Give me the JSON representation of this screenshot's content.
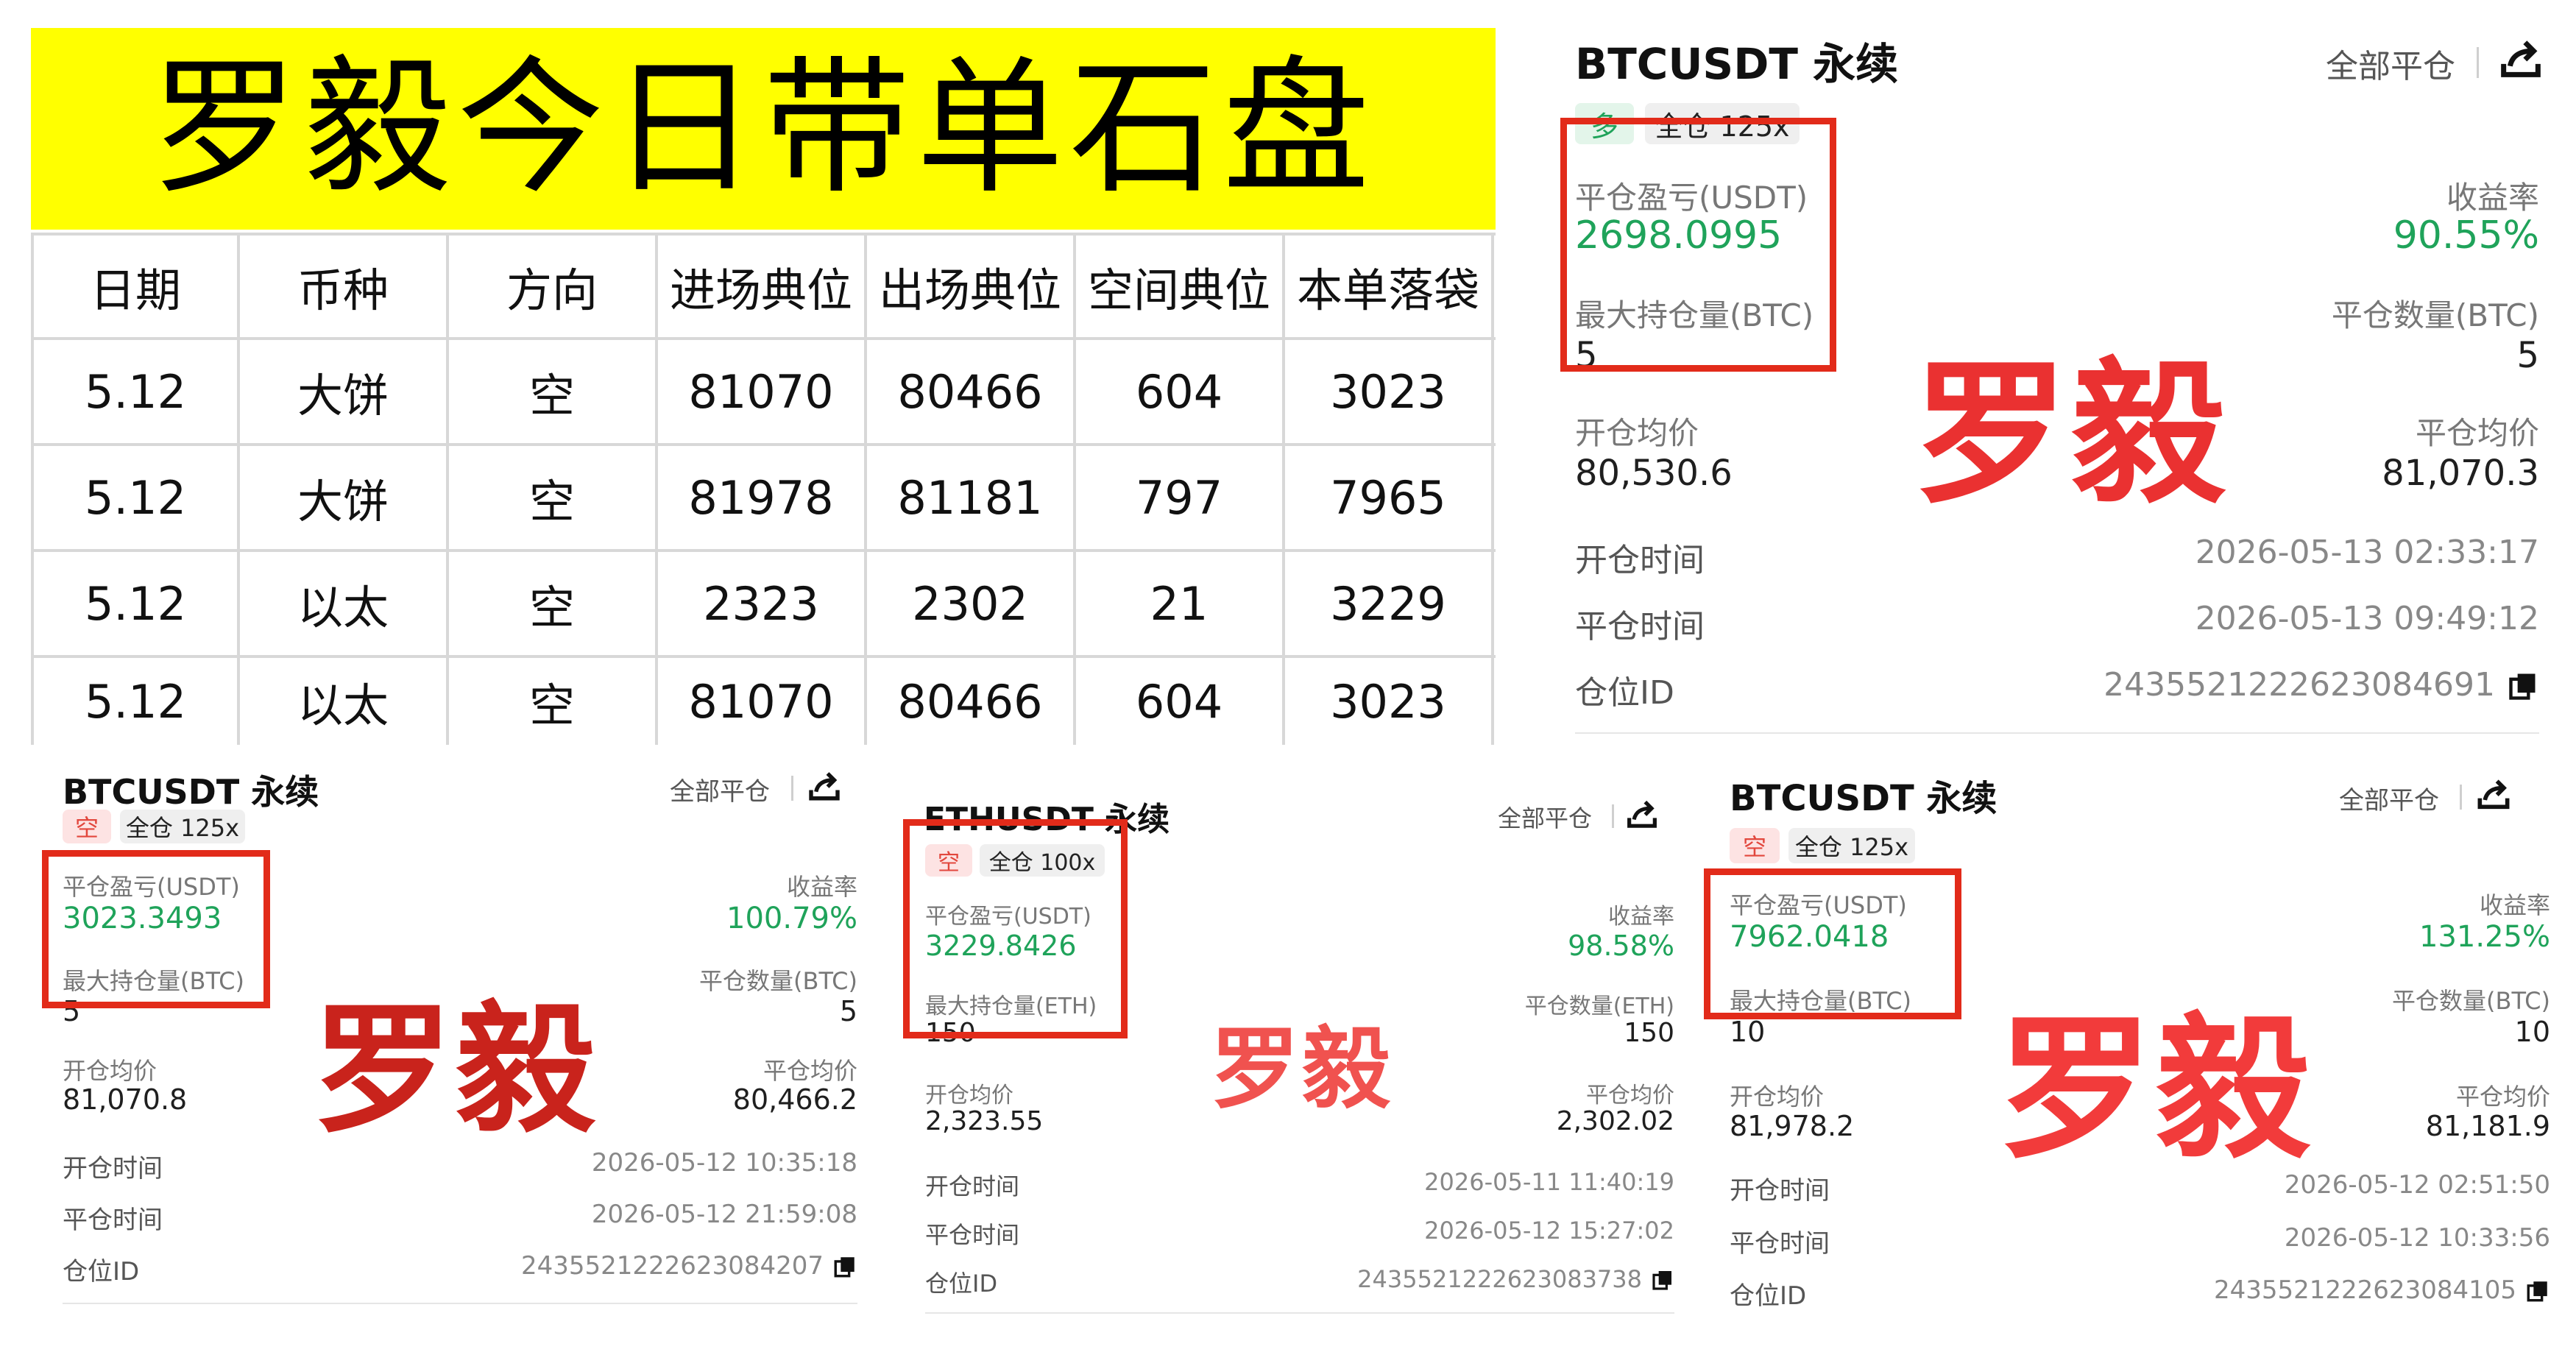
{
  "banner": {
    "title": "罗毅今日带单石盘"
  },
  "table": {
    "headers": [
      "日期",
      "币种",
      "方向",
      "进场典位",
      "出场典位",
      "空间典位",
      "本单落袋"
    ],
    "rows": [
      [
        "5.12",
        "大饼",
        "空",
        "81070",
        "80466",
        "604",
        "3023"
      ],
      [
        "5.12",
        "大饼",
        "空",
        "81978",
        "81181",
        "797",
        "7965"
      ],
      [
        "5.12",
        "以太",
        "空",
        "2323",
        "2302",
        "21",
        "3229"
      ],
      [
        "5.12",
        "以太",
        "空",
        "81070",
        "80466",
        "604",
        "3023"
      ]
    ]
  },
  "cards": {
    "main": {
      "title": "BTCUSDT 永续",
      "close_all": "全部平仓",
      "side": "多",
      "margin": "全仓 125x",
      "pnl_label": "平仓盈亏(USDT)",
      "pnl": "2698.0995",
      "roi_label": "收益率",
      "roi": "90.55%",
      "maxpos_label": "最大持仓量(BTC)",
      "maxpos": "5",
      "closeqty_label": "平仓数量(BTC)",
      "closeqty": "5",
      "open_avg_label": "开仓均价",
      "open_avg": "80,530.6",
      "close_avg_label": "平仓均价",
      "close_avg": "81,070.3",
      "open_time_label": "开仓时间",
      "open_time": "2026-05-13 02:33:17",
      "close_time_label": "平仓时间",
      "close_time": "2026-05-13 09:49:12",
      "pos_id_label": "仓位ID",
      "pos_id": "2435521222623084691",
      "watermark": "罗毅"
    },
    "bl": {
      "title": "BTCUSDT 永续",
      "close_all": "全部平仓",
      "side": "空",
      "margin": "全仓 125x",
      "pnl_label": "平仓盈亏(USDT)",
      "pnl": "3023.3493",
      "roi_label": "收益率",
      "roi": "100.79%",
      "maxpos_label": "最大持仓量(BTC)",
      "maxpos": "5",
      "closeqty_label": "平仓数量(BTC)",
      "closeqty": "5",
      "open_avg_label": "开仓均价",
      "open_avg": "81,070.8",
      "close_avg_label": "平仓均价",
      "close_avg": "80,466.2",
      "open_time_label": "开仓时间",
      "open_time": "2026-05-12 10:35:18",
      "close_time_label": "平仓时间",
      "close_time": "2026-05-12 21:59:08",
      "pos_id_label": "仓位ID",
      "pos_id": "2435521222623084207",
      "watermark": "罗毅"
    },
    "bm": {
      "title": "ETHUSDT 永续",
      "close_all": "全部平仓",
      "side": "空",
      "margin": "全仓 100x",
      "pnl_label": "平仓盈亏(USDT)",
      "pnl": "3229.8426",
      "roi_label": "收益率",
      "roi": "98.58%",
      "maxpos_label": "最大持仓量(ETH)",
      "maxpos": "150",
      "closeqty_label": "平仓数量(ETH)",
      "closeqty": "150",
      "open_avg_label": "开仓均价",
      "open_avg": "2,323.55",
      "close_avg_label": "平仓均价",
      "close_avg": "2,302.02",
      "open_time_label": "开仓时间",
      "open_time": "2026-05-11 11:40:19",
      "close_time_label": "平仓时间",
      "close_time": "2026-05-12 15:27:02",
      "pos_id_label": "仓位ID",
      "pos_id": "2435521222623083738",
      "watermark": "罗毅"
    },
    "br": {
      "title": "BTCUSDT 永续",
      "close_all": "全部平仓",
      "side": "空",
      "margin": "全仓 125x",
      "pnl_label": "平仓盈亏(USDT)",
      "pnl": "7962.0418",
      "roi_label": "收益率",
      "roi": "131.25%",
      "maxpos_label": "最大持仓量(BTC)",
      "maxpos": "10",
      "closeqty_label": "平仓数量(BTC)",
      "closeqty": "10",
      "open_avg_label": "开仓均价",
      "open_avg": "81,978.2",
      "close_avg_label": "平仓均价",
      "close_avg": "81,181.9",
      "open_time_label": "开仓时间",
      "open_time": "2026-05-12 02:51:50",
      "close_time_label": "平仓时间",
      "close_time": "2026-05-12 10:33:56",
      "pos_id_label": "仓位ID",
      "pos_id": "2435521222623084105",
      "watermark": "罗毅"
    }
  },
  "colors": {
    "profit": "#1fa35a",
    "short": "#e2473d",
    "highlight_box": "#e22b1a",
    "banner": "#ffff00"
  },
  "icons": {
    "share": "share-icon",
    "copy": "copy-icon"
  }
}
